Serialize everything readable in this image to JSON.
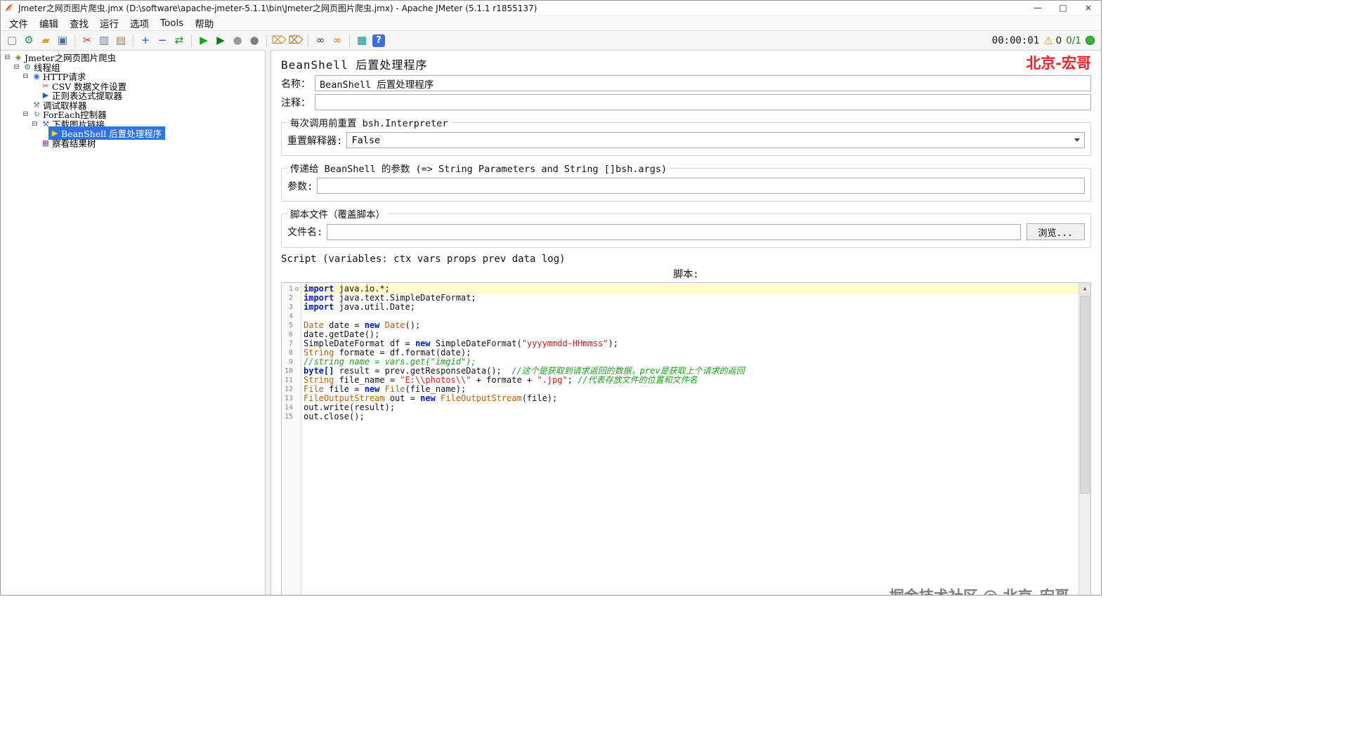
{
  "window": {
    "title": "Jmeter之网页图片爬虫.jmx (D:\\software\\apache-jmeter-5.1.1\\bin\\Jmeter之网页图片爬虫.jmx) - Apache JMeter (5.1.1 r1855137)"
  },
  "menu": {
    "items": [
      {
        "label": "文件",
        "name": "menu-file"
      },
      {
        "label": "编辑",
        "name": "menu-edit"
      },
      {
        "label": "查找",
        "name": "menu-search"
      },
      {
        "label": "运行",
        "name": "menu-run"
      },
      {
        "label": "选项",
        "name": "menu-options"
      },
      {
        "label": "Tools",
        "name": "menu-tools"
      },
      {
        "label": "帮助",
        "name": "menu-help"
      }
    ]
  },
  "toolbar": {
    "timer": "00:00:01",
    "warning_count": "0",
    "active_threads": "0/1",
    "icons": [
      {
        "name": "new-file-icon",
        "glyph": "▢",
        "color": "#7d7d7d"
      },
      {
        "name": "template-icon",
        "glyph": "⚙",
        "color": "#2e8b57"
      },
      {
        "name": "open-file-icon",
        "glyph": "▰",
        "color": "#d9a520"
      },
      {
        "name": "save-icon",
        "glyph": "▣",
        "color": "#4a6fa5"
      },
      {
        "name": "separator"
      },
      {
        "name": "cut-icon",
        "glyph": "✂",
        "color": "#cc2b2b"
      },
      {
        "name": "copy-icon",
        "glyph": "▥",
        "color": "#6b7b8c"
      },
      {
        "name": "paste-icon",
        "glyph": "▤",
        "color": "#9a7b4f"
      },
      {
        "name": "separator"
      },
      {
        "name": "expand-icon",
        "glyph": "+",
        "color": "#2255cc"
      },
      {
        "name": "collapse-icon",
        "glyph": "−",
        "color": "#2255cc"
      },
      {
        "name": "toggle-icon",
        "glyph": "⇄",
        "color": "#2e8b57"
      },
      {
        "name": "separator"
      },
      {
        "name": "start-icon",
        "glyph": "▶",
        "color": "#18a518"
      },
      {
        "name": "start-no-pauses-icon",
        "glyph": "▶",
        "color": "#0c7a0c"
      },
      {
        "name": "stop-icon",
        "glyph": "●",
        "color": "#9b9b9b"
      },
      {
        "name": "shutdown-icon",
        "glyph": "●",
        "color": "#7f7f7f"
      },
      {
        "name": "separator"
      },
      {
        "name": "clear-icon",
        "glyph": "⌦",
        "color": "#c29a2a"
      },
      {
        "name": "clear-all-icon",
        "glyph": "⌦",
        "color": "#a07e1a"
      },
      {
        "name": "separator"
      },
      {
        "name": "search-icon",
        "glyph": "∞",
        "color": "#3a3a3a"
      },
      {
        "name": "search-reset-icon",
        "glyph": "∞",
        "color": "#b8860b"
      },
      {
        "name": "separator"
      },
      {
        "name": "function-helper-icon",
        "glyph": "▦",
        "color": "#0a8a8a"
      },
      {
        "name": "help-icon",
        "glyph": "?",
        "color": "#ffffff",
        "boxed": true
      }
    ]
  },
  "tree": {
    "nodes": [
      {
        "name": "tree-node-test-plan",
        "label": "Jmeter之网页图片爬虫",
        "level": 0,
        "children": true,
        "icon": "test-plan-icon",
        "glyph": "◈",
        "color": "#8a6d3b"
      },
      {
        "name": "tree-node-thread-group",
        "label": "线程组",
        "level": 1,
        "children": true,
        "icon": "thread-group-icon",
        "glyph": "⚙",
        "color": "#2e8b57"
      },
      {
        "name": "tree-node-http-request",
        "label": "HTTP请求",
        "level": 2,
        "children": true,
        "icon": "http-request-icon",
        "glyph": "◉",
        "color": "#3a6fd8"
      },
      {
        "name": "tree-node-csv-data-set",
        "label": "CSV 数据文件设置",
        "level": 3,
        "children": false,
        "icon": "csv-config-icon",
        "glyph": "✂",
        "color": "#cc3333"
      },
      {
        "name": "tree-node-regex-extractor",
        "label": "正则表达式提取器",
        "level": 3,
        "children": false,
        "icon": "regex-extractor-icon",
        "glyph": "▶",
        "color": "#0a65d0"
      },
      {
        "name": "tree-node-debug-sampler",
        "label": "调试取样器",
        "level": 2,
        "children": false,
        "icon": "debug-sampler-icon",
        "glyph": "⚒",
        "color": "#6b7b8c"
      },
      {
        "name": "tree-node-foreach-controller",
        "label": "ForEach控制器",
        "level": 2,
        "children": true,
        "icon": "foreach-controller-icon",
        "glyph": "↻",
        "color": "#2e8b22"
      },
      {
        "name": "tree-node-download-image-link",
        "label": "下载图片链接",
        "level": 3,
        "children": true,
        "icon": "http-request-icon",
        "glyph": "⚒",
        "color": "#3a6fd8"
      },
      {
        "name": "tree-node-beanshell-postprocessor",
        "label": "BeanShell 后置处理程序",
        "level": 4,
        "children": false,
        "selected": true,
        "icon": "beanshell-postprocessor-icon",
        "glyph": "▶",
        "color": "#ffd700"
      },
      {
        "name": "tree-node-view-results-tree",
        "label": "察看结果树",
        "level": 3,
        "children": false,
        "icon": "view-results-tree-icon",
        "glyph": "▦",
        "color": "#8a44aa"
      }
    ]
  },
  "main": {
    "title": "BeanShell 后置处理程序",
    "brand": "北京-宏哥",
    "fields": {
      "name_label": "名称：",
      "name_value": "BeanShell 后置处理程序",
      "comment_label": "注释：",
      "comment_value": ""
    },
    "reset_group": {
      "legend": "每次调用前重置 bsh.Interpreter",
      "label": "重置解释器:",
      "value": "False"
    },
    "params_group": {
      "legend": "传递给 BeanShell 的参数 (=> String Parameters and String []bsh.args)",
      "label": "参数:",
      "value": ""
    },
    "file_group": {
      "legend": "脚本文件（覆盖脚本）",
      "label": "文件名:",
      "value": "",
      "browse_label": "浏览..."
    },
    "script_caption": "Script (variables: ctx vars props prev data log)",
    "script_label": "脚本:",
    "watermark": "掘金技术社区 @ 北京_宏哥"
  },
  "editor": {
    "current_line": 1,
    "fold_line": 1,
    "lines": [
      [
        [
          "k",
          "import"
        ],
        [
          "p",
          " java.io.*;"
        ]
      ],
      [
        [
          "k",
          "import"
        ],
        [
          "p",
          " java.text.SimpleDateFormat;"
        ]
      ],
      [
        [
          "k",
          "import"
        ],
        [
          "p",
          " java.util.Date;"
        ]
      ],
      [],
      [
        [
          "t",
          "Date"
        ],
        [
          "p",
          " date = "
        ],
        [
          "k",
          "new"
        ],
        [
          "p",
          " "
        ],
        [
          "t",
          "Date"
        ],
        [
          "p",
          "();"
        ]
      ],
      [
        [
          "p",
          "date.getDate();"
        ]
      ],
      [
        [
          "p",
          "SimpleDateFormat df = "
        ],
        [
          "k",
          "new"
        ],
        [
          "p",
          " SimpleDateFormat("
        ],
        [
          "s",
          "\"yyyymmdd-HHmmss\""
        ],
        [
          "p",
          ");"
        ]
      ],
      [
        [
          "t",
          "String"
        ],
        [
          "p",
          " formate = df.format(date);"
        ]
      ],
      [
        [
          "c",
          "//string name = vars.get(\"imgid\");"
        ]
      ],
      [
        [
          "k",
          "byte[]"
        ],
        [
          "p",
          " result = prev.getResponseData();  "
        ],
        [
          "c",
          "//这个是获取到请求返回的数据，prev是获取上个请求的返回"
        ]
      ],
      [
        [
          "t",
          "String"
        ],
        [
          "p",
          " file_name = "
        ],
        [
          "s",
          "\"E:\\\\photos\\\\\""
        ],
        [
          "p",
          " + formate + "
        ],
        [
          "s",
          "\".jpg\""
        ],
        [
          "p",
          "; "
        ],
        [
          "c",
          "//代表存放文件的位置和文件名"
        ]
      ],
      [
        [
          "t",
          "File"
        ],
        [
          "p",
          " file = "
        ],
        [
          "k",
          "new"
        ],
        [
          "p",
          " "
        ],
        [
          "t",
          "File"
        ],
        [
          "p",
          "(file_name);"
        ]
      ],
      [
        [
          "t",
          "FileOutputStream"
        ],
        [
          "p",
          " out = "
        ],
        [
          "k",
          "new"
        ],
        [
          "p",
          " "
        ],
        [
          "t",
          "FileOutputStream"
        ],
        [
          "p",
          "(file);"
        ]
      ],
      [
        [
          "p",
          "out.write(result);"
        ]
      ],
      [
        [
          "p",
          "out.close();"
        ]
      ]
    ]
  }
}
